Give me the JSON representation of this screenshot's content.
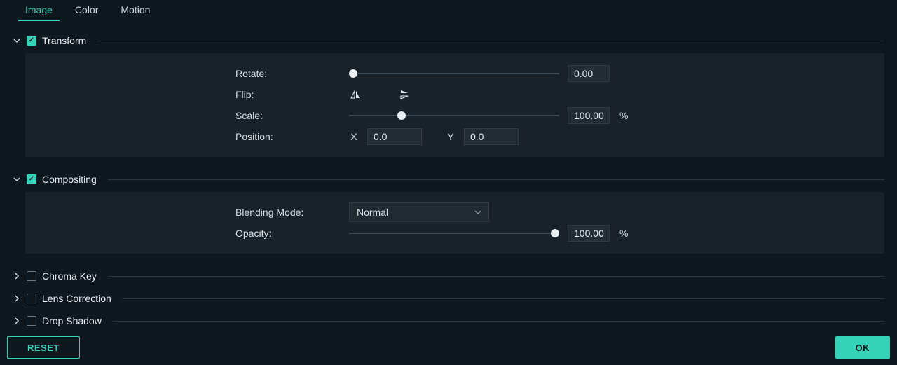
{
  "tabs": {
    "image": "Image",
    "color": "Color",
    "motion": "Motion",
    "active": "image"
  },
  "sections": {
    "transform": {
      "title": "Transform",
      "checked": true,
      "expanded": true,
      "rotate": {
        "label": "Rotate:",
        "value": "0.00"
      },
      "flip": {
        "label": "Flip:"
      },
      "scale": {
        "label": "Scale:",
        "value": "100.00",
        "unit": "%"
      },
      "position": {
        "label": "Position:",
        "x_label": "X",
        "x": "0.0",
        "y_label": "Y",
        "y": "0.0"
      }
    },
    "compositing": {
      "title": "Compositing",
      "checked": true,
      "expanded": true,
      "blend": {
        "label": "Blending Mode:",
        "value": "Normal"
      },
      "opacity": {
        "label": "Opacity:",
        "value": "100.00",
        "unit": "%"
      }
    },
    "chroma": {
      "title": "Chroma Key",
      "checked": false,
      "expanded": false
    },
    "lens": {
      "title": "Lens Correction",
      "checked": false,
      "expanded": false
    },
    "shadow": {
      "title": "Drop Shadow",
      "checked": false,
      "expanded": false
    }
  },
  "buttons": {
    "reset": "RESET",
    "ok": "OK"
  },
  "colors": {
    "accent": "#34d3b7",
    "bg": "#10181f",
    "panel": "#192229"
  }
}
